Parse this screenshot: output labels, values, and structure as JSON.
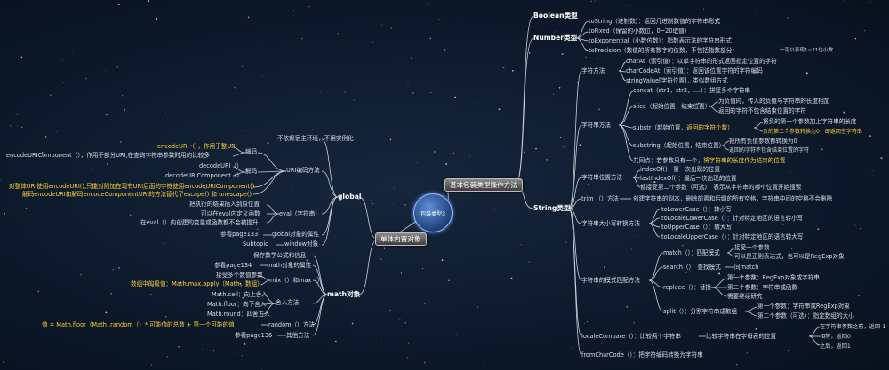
{
  "root": "包装类型3",
  "main_branches": {
    "basic": "基本包装类型操作方法",
    "builtin": "单体内置对象"
  },
  "right": {
    "boolean": "Boolean类型",
    "number": "Number类型",
    "number_methods": [
      "toString（进制数）：返回几进制数值的字符串形式",
      "toFixed（保留的小数位，0~20取值）",
      "toExponential（小数位数）：指数表示法的字符串形式",
      "toPrecision（数值的所有数字的位数，不包括指数部分）"
    ],
    "precision_note": "一可以表现1~21位小数",
    "string": "String类型",
    "char_methods": "字符方法",
    "charAt": "charAt（索引值）：以单字符串的形式返回指定位置的字符",
    "charCodeAt": "charCodeAt（索引值）：返回该位置字符的字符编码",
    "stringValue": "stringValue[字符位置]，类似数组方式",
    "string_ops": "字符串方法",
    "concat": "concat（str1，str2，....）：拼接多个字符串",
    "slice": "slice（起始位置，结束位置）",
    "slice_notes": [
      "为负值时，传入的负值与字符串的长度相加",
      "返回的字符不包含结束位置的字符"
    ],
    "substr_a": "substr（起始位置，",
    "substr_b": "返回的字符个数）",
    "substr_notes": [
      "将负的第一个参数加上字符串的长度",
      "负的第二个参数转换为0，即返回空字符串"
    ],
    "substring": "substring（起始位置，结束位置）",
    "substring_notes": [
      "把所有负值参数都转换为0",
      "返回的字符不包含结束位置的字符"
    ],
    "common_a": "共同点：若参数只有一个，",
    "common_b": "将字符串的长度作为结束的位置",
    "position_methods": "字符串位置方法",
    "indexOf": "indexOf()：第一次出现的位置",
    "lastIndexOf": "lastIndexOf()：最后一次出现的位置",
    "position_note": "都接受第二个参数（可选）：表示从字符串的哪个位置开始搜索",
    "trim": "trim （）方法",
    "trim_desc": "创建字符串的副本，删除前置和后缀的所有空格，字符串中间的空格不会删除",
    "case_methods": "字符串大小写转换方法",
    "case_items": [
      "toLowerCase（）：转小写",
      "toLocaleLowerCase（）：针对特定地区的语言转小写",
      "toUpperCase（）：转大写",
      "toLocaleUpperCase（）：针对特定地区的语言转大写"
    ],
    "pattern_methods": "字符串的模式匹配方法",
    "match": "match（）：匹配模式",
    "match_notes": [
      "接受一个参数",
      "可以是正则表达式，也可以是RegExp对象"
    ],
    "search": "search（）：查找模式",
    "search_note": "同match",
    "replace": "replace（）：替换",
    "replace_notes": [
      "第一个参数：RegExp对象或字符串",
      "第二个参数：字符串或函数",
      "需要继续研究"
    ],
    "split": "split（）：分割字符串成数组",
    "split_notes": [
      "第一个参数：字符串或RegExp对象",
      "第二个参数（可选）：指定数组的大小"
    ],
    "localeCompare": "localeCompare（）：比较两个字符串",
    "localeCompare_desc": "比较字符串在字母表的位置",
    "localeCompare_results": [
      "在字符串参数之前，返回-1",
      "相等，返回0",
      "之后，返回1"
    ],
    "fromCharCode": "fromCharCode（）：把字符编码转换为字符串"
  },
  "left": {
    "global": "global",
    "global_top": "不依赖宿主环境，不用实例化",
    "uri_methods": "URI编码方法",
    "encode": "编码",
    "encodeURI": "encodeURI（），作用于整URI",
    "encodeURIComponent": "encodeURIComponent（），作用于部分URI,在查询字符串参数时用的比较多",
    "decode": "解码",
    "decodeURI": "decodeURI（）",
    "decodeURIComponent": "decodeURIComponent（）",
    "escape_note_1": "对整体URI使用encodeURI(),只能对附加在现有URI后面的字符使用encodeURIComponent()",
    "escape_note_2": "解码encodeURI和解码encodeComponentURI的方法替代了escape() 和 unescape()",
    "eval": "eval（字符串）",
    "eval_notes": [
      "把执行的结果插入到原位置",
      "可以在eval内定义函数",
      "在eval（）内创建的变量或函数都不会被提升"
    ],
    "global_props": "global对象的属性",
    "global_props_ref": "参看page133",
    "window": "window对象",
    "window_note": "Subtopic",
    "math": "math对象",
    "math_desc": "保存数学公式和信息",
    "math_props": "math对象的属性",
    "math_props_ref": "参看page134",
    "minmax": "mix（）和max（）",
    "minmax_notes": [
      "接受多个数值参数",
      "数组中的极值：Math.max.apply（Math，数组）"
    ],
    "rounding": "舍入方法",
    "rounding_items": [
      "Math.ceil：向上舍入",
      "Math.floor：向下舍入",
      "Math.round：四舍五入"
    ],
    "random": "random（）方法",
    "random_formula": "值 = Math.floor（Math .random（）* 可能值的总数 + 第一个可能的值",
    "other": "其他方法",
    "other_ref": "参看page136"
  }
}
